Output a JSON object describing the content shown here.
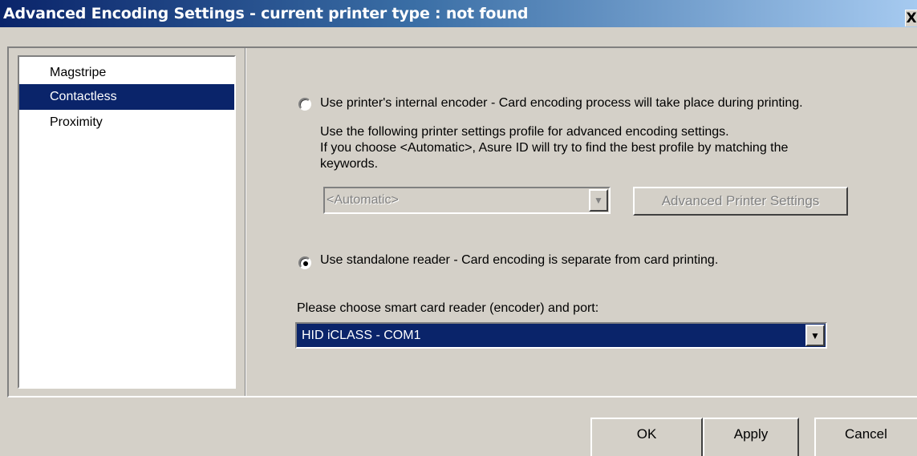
{
  "window": {
    "title": "Advanced Encoding Settings - current printer type : not found",
    "close_label": "X"
  },
  "sidebar": {
    "items": [
      {
        "label": "Magstripe",
        "selected": false
      },
      {
        "label": "Contactless",
        "selected": true
      },
      {
        "label": "Proximity",
        "selected": false
      }
    ]
  },
  "internal_encoder": {
    "label": "Use printer's internal encoder - Card encoding process will take place during printing.",
    "selected": false,
    "description_line1": "Use the following printer settings profile for advanced encoding settings.",
    "description_line2": "If you choose <Automatic>, Asure ID will try to find the best profile by matching the",
    "description_line3": "keywords.",
    "profile_value": "<Automatic>",
    "advanced_button_label": "Advanced Printer Settings"
  },
  "standalone_reader": {
    "label": "Use standalone reader - Card encoding is separate from card printing.",
    "selected": true,
    "prompt": "Please choose smart card reader (encoder) and port:",
    "reader_value": "HID iCLASS - COM1"
  },
  "footer": {
    "ok_label": "OK",
    "apply_label": "Apply",
    "cancel_label": "Cancel"
  },
  "colors": {
    "title_gradient_start": "#0a246a",
    "title_gradient_end": "#a6caf0",
    "selection": "#0a246a",
    "dialog_face": "#d4d0c8"
  }
}
